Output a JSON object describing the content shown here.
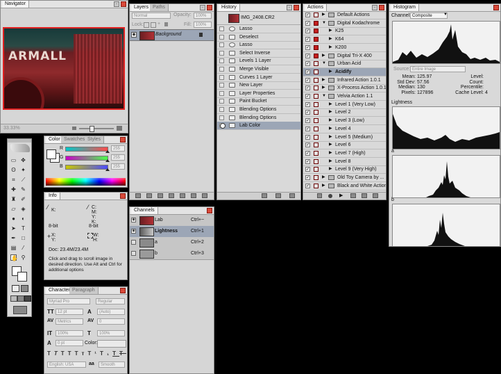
{
  "navigator": {
    "tab": "Navigator",
    "zoom": "33.33%",
    "thumb_text": "ARMALL"
  },
  "layers": {
    "tabs": [
      "Layers",
      "Paths"
    ],
    "blend_mode": "Normal",
    "opacity_label": "Opacity:",
    "opacity_value": "100%",
    "lock_label": "Lock:",
    "fill_label": "Fill:",
    "fill_value": "100%",
    "layer_name": "Background"
  },
  "history": {
    "tab": "History",
    "snapshot": "IMG_2408.CR2",
    "items": [
      "Lasso",
      "Deselect",
      "Lasso",
      "Select Inverse",
      "Levels 1 Layer",
      "Merge Visible",
      "Curves 1 Layer",
      "New Layer",
      "Layer Properties",
      "Paint Bucket",
      "Blending Options",
      "Blending Options",
      "Lab Color"
    ]
  },
  "actions": {
    "tab": "Actions",
    "items": [
      {
        "label": "Default Actions",
        "kind": "set",
        "open": false,
        "red": false
      },
      {
        "label": "Digital Kodachrome",
        "kind": "set",
        "open": true,
        "red": true
      },
      {
        "label": "K25",
        "kind": "action",
        "open": false,
        "red": true
      },
      {
        "label": "K64",
        "kind": "action",
        "open": false,
        "red": true
      },
      {
        "label": "K200",
        "kind": "action",
        "open": false,
        "red": true
      },
      {
        "label": "Digital Tri-X 400",
        "kind": "set",
        "open": false,
        "red": true
      },
      {
        "label": "Urban Acid",
        "kind": "set",
        "open": true,
        "red": false
      },
      {
        "label": "Acidify",
        "kind": "action",
        "open": false,
        "red": false,
        "selected": true
      },
      {
        "label": "Infrared Action 1.0.1",
        "kind": "set",
        "open": false,
        "red": false
      },
      {
        "label": "X-Process Action 1.0.1",
        "kind": "set",
        "open": false,
        "red": false
      },
      {
        "label": "Velvia Action 1.1",
        "kind": "set",
        "open": true,
        "red": false
      },
      {
        "label": "Level 1 (Very Low)",
        "kind": "action",
        "open": false,
        "red": false
      },
      {
        "label": "Level 2",
        "kind": "action",
        "open": false,
        "red": false
      },
      {
        "label": "Level  3 (Low)",
        "kind": "action",
        "open": false,
        "red": false
      },
      {
        "label": "Level 4",
        "kind": "action",
        "open": false,
        "red": false
      },
      {
        "label": "Level 5 (Medium)",
        "kind": "action",
        "open": false,
        "red": false
      },
      {
        "label": "Level 6",
        "kind": "action",
        "open": false,
        "red": false
      },
      {
        "label": "Level 7 (High)",
        "kind": "action",
        "open": false,
        "red": false
      },
      {
        "label": "Level 8",
        "kind": "action",
        "open": false,
        "red": false
      },
      {
        "label": "Level 9 (Very High)",
        "kind": "action",
        "open": false,
        "red": false
      },
      {
        "label": "Old Toy Camera by ...",
        "kind": "set",
        "open": false,
        "red": false
      },
      {
        "label": "Black and White Action",
        "kind": "set",
        "open": false,
        "red": false
      }
    ]
  },
  "histogram": {
    "tab": "Histogram",
    "channel_label": "Channel:",
    "channel_value": "Composite",
    "source_label": "Source:",
    "source_value": "Entire Image",
    "stats_left": [
      {
        "label": "Mean:",
        "value": "125.97"
      },
      {
        "label": "Std Dev:",
        "value": "57.56"
      },
      {
        "label": "Median:",
        "value": "130"
      },
      {
        "label": "Pixels:",
        "value": "127896"
      }
    ],
    "stats_right": [
      {
        "label": "Level:",
        "value": ""
      },
      {
        "label": "Count:",
        "value": ""
      },
      {
        "label": "Percentile:",
        "value": ""
      },
      {
        "label": "Cache Level:",
        "value": "4"
      }
    ],
    "label_lightness": "Lightness",
    "label_a": "a",
    "label_b": "b"
  },
  "color": {
    "tabs": [
      "Color",
      "Swatches",
      "Styles"
    ],
    "sliders": [
      {
        "label": "R",
        "value": "255"
      },
      {
        "label": "G",
        "value": "255"
      },
      {
        "label": "B",
        "value": "255"
      }
    ]
  },
  "info": {
    "tab": "Info",
    "k1": "K:",
    "c": "C:",
    "m": "M:",
    "y": "Y:",
    "k2": "K:",
    "bit1": "8-bit",
    "bit2": "8-bit",
    "x": "X:",
    "y2": "Y:",
    "w": "W:",
    "h": "H:",
    "doc": "Doc: 23.4M/23.4M",
    "hint": "Click and drag to scroll image in desired direction.  Use Alt and Ctrl for additional options"
  },
  "character": {
    "tabs": [
      "Character",
      "Paragraph"
    ],
    "font": "Myriad Pro",
    "style": "Regular",
    "size": "12 pt",
    "leading": "(Auto)",
    "kerning": "Metrics",
    "tracking": "0",
    "vscale": "100%",
    "hscale": "100%",
    "baseline": "0 pt",
    "color_label": "Color:",
    "language": "English: USA",
    "aa": "Smooth"
  },
  "channels": {
    "tab": "Channels",
    "rows": [
      {
        "name": "Lab",
        "shortcut": "Ctrl+~"
      },
      {
        "name": "Lightness",
        "shortcut": "Ctrl+1"
      },
      {
        "name": "a",
        "shortcut": "Ctrl+2"
      },
      {
        "name": "b",
        "shortcut": "Ctrl+3"
      }
    ]
  }
}
